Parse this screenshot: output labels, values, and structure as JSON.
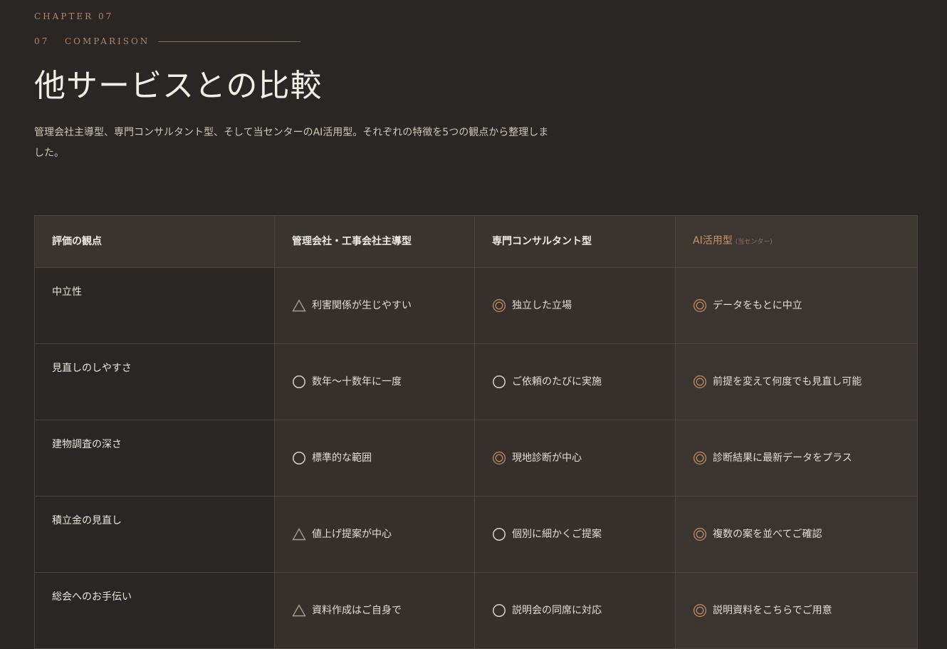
{
  "header": {
    "chapter": "CHAPTER 07",
    "section_number": "07",
    "section_label": "COMPARISON",
    "title": "他サービスとの比較",
    "intro": "管理会社主導型、専門コンサルタント型、そして当センターのAI活用型。それぞれの特徴を5つの観点から整理しました。"
  },
  "colors": {
    "background": "#2a2623",
    "accent": "#b7865e",
    "highlight_text": "#c9936a",
    "border": "#4c4540"
  },
  "table": {
    "headers": {
      "aspect": "評価の観点",
      "mgmt": "管理会社・工事会社主導型",
      "consult": "専門コンサルタント型",
      "ai": "AI活用型",
      "ai_note": "(当センター)"
    },
    "rows": [
      {
        "aspect": "中立性",
        "mgmt": {
          "mark": "triangle-icon",
          "text": "利害関係が生じやすい"
        },
        "consult": {
          "mark": "double-circle-icon",
          "text": "独立した立場"
        },
        "ai": {
          "mark": "double-circle-icon",
          "text": "データをもとに中立"
        }
      },
      {
        "aspect": "見直しのしやすさ",
        "mgmt": {
          "mark": "circle-icon",
          "text": "数年〜十数年に一度"
        },
        "consult": {
          "mark": "circle-icon",
          "text": "ご依頼のたびに実施"
        },
        "ai": {
          "mark": "double-circle-icon",
          "text": "前提を変えて何度でも見直し可能"
        }
      },
      {
        "aspect": "建物調査の深さ",
        "mgmt": {
          "mark": "circle-icon",
          "text": "標準的な範囲"
        },
        "consult": {
          "mark": "double-circle-icon",
          "text": "現地診断が中心"
        },
        "ai": {
          "mark": "double-circle-icon",
          "text": "診断結果に最新データをプラス"
        }
      },
      {
        "aspect": "積立金の見直し",
        "mgmt": {
          "mark": "triangle-icon",
          "text": "値上げ提案が中心"
        },
        "consult": {
          "mark": "circle-icon",
          "text": "個別に細かくご提案"
        },
        "ai": {
          "mark": "double-circle-icon",
          "text": "複数の案を並べてご確認"
        }
      },
      {
        "aspect": "総会へのお手伝い",
        "mgmt": {
          "mark": "triangle-icon",
          "text": "資料作成はご自身で"
        },
        "consult": {
          "mark": "circle-icon",
          "text": "説明会の同席に対応"
        },
        "ai": {
          "mark": "double-circle-icon",
          "text": "説明資料をこちらでご用意"
        }
      }
    ]
  }
}
